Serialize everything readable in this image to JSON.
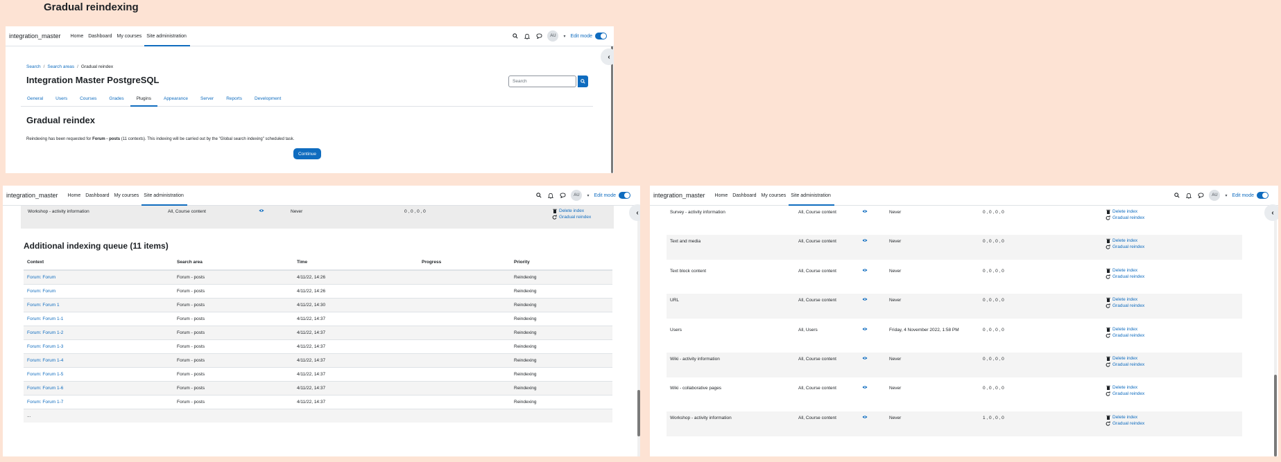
{
  "page_heading": "Gradual reindexing",
  "navbar": {
    "brand": "integration_master",
    "links": [
      "Home",
      "Dashboard",
      "My courses",
      "Site administration"
    ],
    "avatar": "AU",
    "edit_mode": "Edit mode"
  },
  "panel1": {
    "breadcrumb": [
      "Search",
      "Search areas",
      "Gradual reindex"
    ],
    "site_title": "Integration Master PostgreSQL",
    "search_placeholder": "Search",
    "tabs": [
      "General",
      "Users",
      "Courses",
      "Grades",
      "Plugins",
      "Appearance",
      "Server",
      "Reports",
      "Development"
    ],
    "active_tab": "Plugins",
    "title": "Gradual reindex",
    "message_prefix": "Reindexing has been requested for ",
    "message_bold": "Forum - posts",
    "message_suffix": " (11 contexts). This indexing will be carried out by the \"Global search indexing\" scheduled task.",
    "continue_label": "Continue"
  },
  "panel2": {
    "top_row": {
      "name": "Workshop - activity information",
      "contexts": "All, Course content",
      "last_indexed": "Never",
      "counts": "0 , 0 , 0 , 0",
      "delete": "Delete index",
      "reindex": "Gradual reindex"
    },
    "queue_title": "Additional indexing queue (11 items)",
    "columns": [
      "Context",
      "Search area",
      "Time",
      "Progress",
      "Priority"
    ],
    "rows": [
      {
        "context": "Forum: Forum",
        "area": "Forum - posts",
        "time": "4/11/22, 14:26",
        "progress": "",
        "priority": "Reindexing"
      },
      {
        "context": "Forum: Forum",
        "area": "Forum - posts",
        "time": "4/11/22, 14:26",
        "progress": "",
        "priority": "Reindexing"
      },
      {
        "context": "Forum: Forum 1",
        "area": "Forum - posts",
        "time": "4/11/22, 14:30",
        "progress": "",
        "priority": "Reindexing"
      },
      {
        "context": "Forum: Forum 1-1",
        "area": "Forum - posts",
        "time": "4/11/22, 14:37",
        "progress": "",
        "priority": "Reindexing"
      },
      {
        "context": "Forum: Forum 1-2",
        "area": "Forum - posts",
        "time": "4/11/22, 14:37",
        "progress": "",
        "priority": "Reindexing"
      },
      {
        "context": "Forum: Forum 1-3",
        "area": "Forum - posts",
        "time": "4/11/22, 14:37",
        "progress": "",
        "priority": "Reindexing"
      },
      {
        "context": "Forum: Forum 1-4",
        "area": "Forum - posts",
        "time": "4/11/22, 14:37",
        "progress": "",
        "priority": "Reindexing"
      },
      {
        "context": "Forum: Forum 1-5",
        "area": "Forum - posts",
        "time": "4/11/22, 14:37",
        "progress": "",
        "priority": "Reindexing"
      },
      {
        "context": "Forum: Forum 1-6",
        "area": "Forum - posts",
        "time": "4/11/22, 14:37",
        "progress": "",
        "priority": "Reindexing"
      },
      {
        "context": "Forum: Forum 1-7",
        "area": "Forum - posts",
        "time": "4/11/22, 14:37",
        "progress": "",
        "priority": "Reindexing"
      }
    ],
    "more": "..."
  },
  "panel3": {
    "rows": [
      {
        "name": "Survey - activity information",
        "contexts": "All, Course content",
        "last_indexed": "Never",
        "counts": "0 , 0 , 0 , 0"
      },
      {
        "name": "Text and media",
        "contexts": "All, Course content",
        "last_indexed": "Never",
        "counts": "0 , 0 , 0 , 0"
      },
      {
        "name": "Text block content",
        "contexts": "All, Course content",
        "last_indexed": "Never",
        "counts": "0 , 0 , 0 , 0"
      },
      {
        "name": "URL",
        "contexts": "All, Course content",
        "last_indexed": "Never",
        "counts": "0 , 0 , 0 , 0"
      },
      {
        "name": "Users",
        "contexts": "All, Users",
        "last_indexed": "Friday, 4 November 2022, 1:58 PM",
        "counts": "0 , 0 , 0 , 0"
      },
      {
        "name": "Wiki - activity information",
        "contexts": "All, Course content",
        "last_indexed": "Never",
        "counts": "0 , 0 , 0 , 0"
      },
      {
        "name": "Wiki - collaborative pages",
        "contexts": "All, Course content",
        "last_indexed": "Never",
        "counts": "0 , 0 , 0 , 0"
      },
      {
        "name": "Workshop - activity information",
        "contexts": "All, Course content",
        "last_indexed": "Never",
        "counts": "1 , 0 , 0 , 0"
      }
    ],
    "delete": "Delete index",
    "reindex": "Gradual reindex"
  },
  "colors": {
    "accent": "#0f6cbf",
    "background": "#fde3d4",
    "row_alt": "#f4f4f4"
  },
  "icons": [
    "search-icon",
    "bell-icon",
    "chat-icon",
    "chevron-left-icon",
    "eye-icon",
    "trash-icon",
    "refresh-icon"
  ]
}
